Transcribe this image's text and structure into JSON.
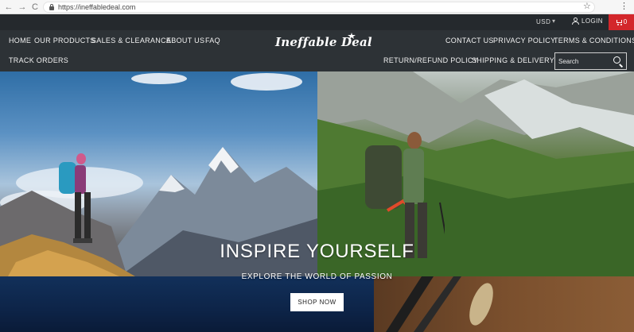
{
  "browser": {
    "back_glyph": "←",
    "forward_glyph": "→",
    "reload_glyph": "C",
    "url": "https://ineffabledeal.com",
    "star_glyph": "☆",
    "menu_glyph": "⋮"
  },
  "topbar": {
    "currency": "USD",
    "currency_caret": "▾",
    "login_label": "LOGIN",
    "cart_count": "0",
    "cart_color": "#d3272b"
  },
  "nav_left": {
    "home": "HOME",
    "our_products": "OUR PRODUCTS",
    "sales": "SALES & CLEARANCE",
    "about": "ABOUT US",
    "faq": "FAQ",
    "track": "TRACK ORDERS"
  },
  "nav_right": {
    "contact": "CONTACT US",
    "privacy": "PRIVACY POLICY",
    "terms": "TERMS & CONDITIONS",
    "returns": "RETURN/REFUND POLICY",
    "shipping": "SHIPPING & DELIVERY"
  },
  "logo": {
    "text": "Ineffable Deal"
  },
  "search": {
    "placeholder": "Search"
  },
  "hero": {
    "title": "INSPIRE YOURSELF",
    "subtitle": "EXPLORE THE WORLD OF PASSION",
    "button_label": "SHOP NOW"
  },
  "icons": [
    "back-arrow-icon",
    "forward-arrow-icon",
    "reload-icon",
    "lock-icon",
    "star-icon",
    "user-icon",
    "cart-icon",
    "search-icon"
  ]
}
